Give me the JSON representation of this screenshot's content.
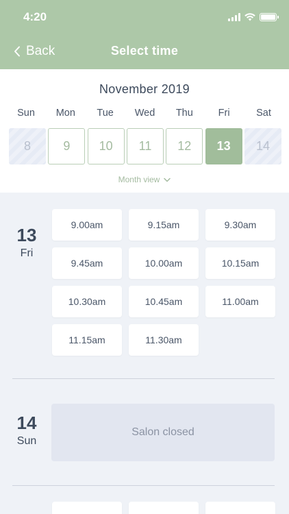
{
  "status_bar": {
    "time": "4:20"
  },
  "nav": {
    "back_label": "Back",
    "title": "Select time"
  },
  "calendar": {
    "month": "November 2019",
    "weekdays": [
      "Sun",
      "Mon",
      "Tue",
      "Wed",
      "Thu",
      "Fri",
      "Sat"
    ],
    "days": [
      {
        "num": "8",
        "state": "disabled"
      },
      {
        "num": "9",
        "state": "available"
      },
      {
        "num": "10",
        "state": "available"
      },
      {
        "num": "11",
        "state": "available"
      },
      {
        "num": "12",
        "state": "available"
      },
      {
        "num": "13",
        "state": "selected"
      },
      {
        "num": "14",
        "state": "disabled"
      }
    ],
    "month_view_label": "Month view"
  },
  "schedule": [
    {
      "date_num": "13",
      "date_dow": "Fri",
      "slots": [
        "9.00am",
        "9.15am",
        "9.30am",
        "9.45am",
        "10.00am",
        "10.15am",
        "10.30am",
        "10.45am",
        "11.00am",
        "11.15am",
        "11.30am"
      ]
    },
    {
      "date_num": "14",
      "date_dow": "Sun",
      "closed_label": "Salon closed"
    }
  ],
  "colors": {
    "header": "#adc8a8",
    "selected_day": "#a1bd9b",
    "background": "#eff2f7"
  }
}
